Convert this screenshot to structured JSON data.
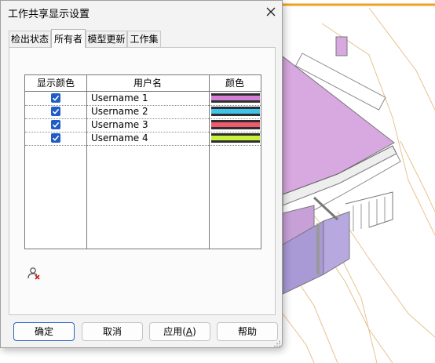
{
  "dialog": {
    "title": "工作共享显示设置",
    "tabs": [
      {
        "label": "检出状态"
      },
      {
        "label": "所有者"
      },
      {
        "label": "模型更新"
      },
      {
        "label": "工作集"
      }
    ],
    "active_tab": "所有者"
  },
  "owners_table": {
    "columns": [
      "显示颜色",
      "用户名",
      "颜色"
    ],
    "rows": [
      {
        "checked": true,
        "username": "Username 1",
        "color": "#d67fd6"
      },
      {
        "checked": true,
        "username": "Username 2",
        "color": "#3ec3ea"
      },
      {
        "checked": true,
        "username": "Username 3",
        "color": "#ef5a6e"
      },
      {
        "checked": true,
        "username": "Username 4",
        "color": "#c9f23a"
      }
    ]
  },
  "footer": {
    "ok_label": "确定",
    "cancel_label": "取消",
    "apply_label_pre": "应用(",
    "apply_label_key": "A",
    "apply_label_post": ")",
    "help_label": "帮助"
  },
  "icons": {
    "close": "close-icon",
    "remove_user": "remove-user-icon",
    "checkbox": "checkmark-icon",
    "resize": "resize-grip-icon"
  }
}
